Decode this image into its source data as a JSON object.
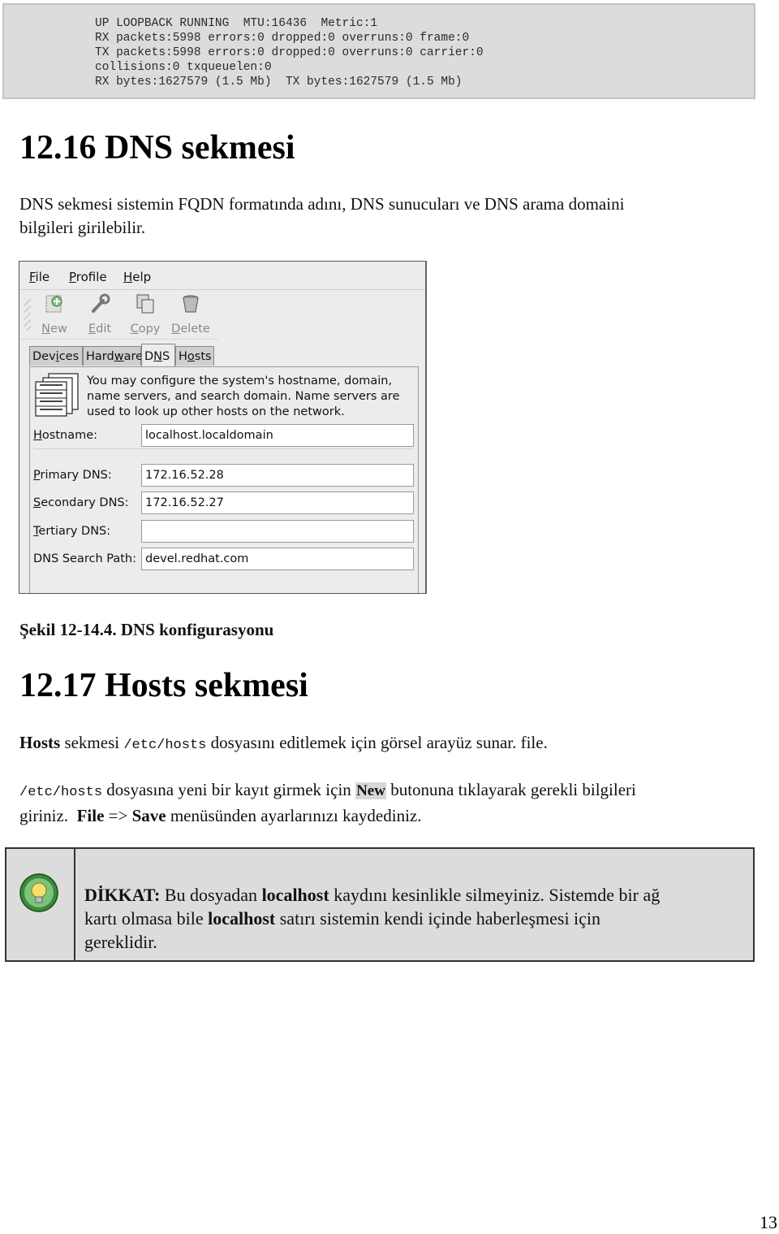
{
  "code_block": {
    "lines": [
      "UP LOOPBACK RUNNING  MTU:16436  Metric:1",
      "RX packets:5998 errors:0 dropped:0 overruns:0 frame:0",
      "TX packets:5998 errors:0 dropped:0 overruns:0 carrier:0",
      "collisions:0 txqueuelen:0",
      "RX bytes:1627579 (1.5 Mb)  TX bytes:1627579 (1.5 Mb)"
    ]
  },
  "section1": {
    "heading": "12.16 DNS sekmesi",
    "para_line1": "DNS sekmesi sistemin FQDN formatında adını, DNS sunucuları ve DNS arama domaini",
    "para_line2": "bilgileri girilebilir."
  },
  "window": {
    "menu": [
      {
        "key": "F",
        "rest": "ile"
      },
      {
        "key": "P",
        "rest": "rofile"
      },
      {
        "key": "H",
        "rest": "elp"
      }
    ],
    "toolbar": [
      {
        "key": "N",
        "rest": "ew",
        "icon": "new-icon"
      },
      {
        "key": "E",
        "rest": "dit",
        "icon": "edit-icon"
      },
      {
        "key": "C",
        "rest": "opy",
        "icon": "copy-icon"
      },
      {
        "key": "D",
        "rest": "elete",
        "icon": "delete-icon"
      }
    ],
    "tabs": [
      {
        "pre": "Dev",
        "key": "i",
        "post": "ces"
      },
      {
        "pre": "Hard",
        "key": "w",
        "post": "are"
      },
      {
        "pre": "D",
        "key": "N",
        "post": "S"
      },
      {
        "pre": "H",
        "key": "o",
        "post": "sts"
      }
    ],
    "active_tab": "DNS",
    "info_line1": "You may configure the system's hostname, domain,",
    "info_line2": "name servers, and search domain. Name servers are",
    "info_line3": "used to look up other hosts on the network.",
    "fields": {
      "hostname": {
        "key": "H",
        "rest": "ostname:",
        "value": "localhost.localdomain"
      },
      "primary": {
        "key": "P",
        "rest": "rimary DNS:",
        "value": "172.16.52.28"
      },
      "secondary": {
        "key": "S",
        "rest": "econdary DNS:",
        "value": "172.16.52.27"
      },
      "tertiary": {
        "key": "T",
        "rest": "ertiary DNS:",
        "value": ""
      },
      "search": {
        "label": "DNS Search Path:",
        "value": "devel.redhat.com"
      }
    }
  },
  "caption": "Şekil 12-14.4. DNS konfigurasyonu",
  "section2": {
    "heading": "12.17 Hosts sekmesi",
    "p1": {
      "bold": "Hosts",
      "t1": " sekmesi ",
      "code": "/etc/hosts",
      "t2": " dosyasını editlemek için görsel arayüz sunar. file."
    },
    "p2": {
      "code": "/etc/hosts",
      "t1": " dosyasına yeni bir kayıt girmek için ",
      "new": "New",
      "t2": " butonuna tıklayarak gerekli bilgileri",
      "t3": "giriniz.  ",
      "file": "File",
      "t4": " => ",
      "save": "Save",
      "t5": " menüsünden ayarlarınızı kaydediniz."
    }
  },
  "note": {
    "label": "DİKKAT:",
    "t1": " Bu dosyadan ",
    "b1": "localhost",
    "t2": " kaydını kesinlikle silmeyiniz. Sistemde bir ağ",
    "t3": "kartı olmasa bile ",
    "b2": "localhost",
    "t4": " satırı sistemin kendi içinde haberleşmesi için",
    "t5": "gereklidir."
  },
  "page_number": "13"
}
